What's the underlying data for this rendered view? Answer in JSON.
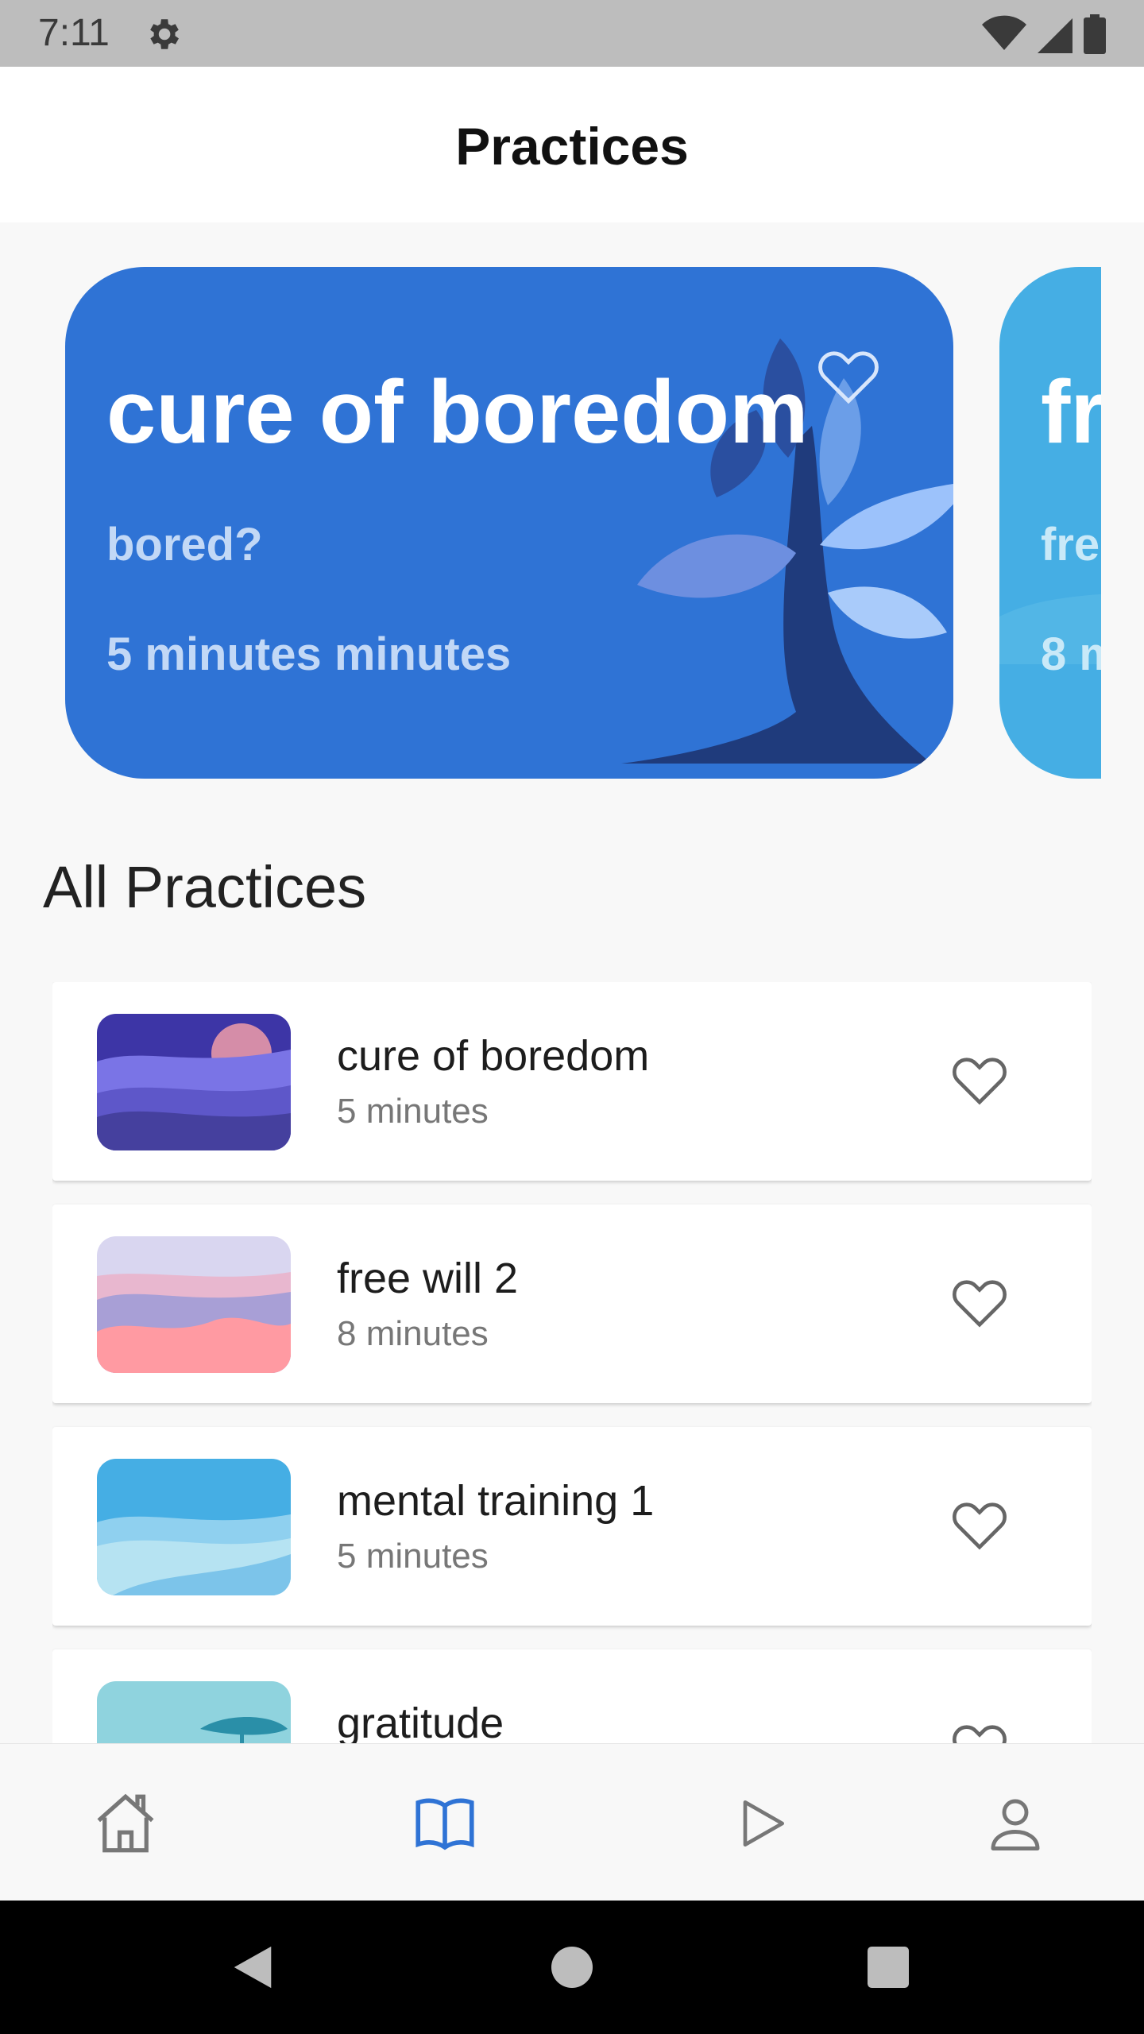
{
  "status_bar": {
    "time": "7:11"
  },
  "header": {
    "title": "Practices"
  },
  "featured": [
    {
      "title": "cure of boredom",
      "subtitle": "bored?",
      "duration": "5 minutes minutes"
    },
    {
      "title": "fr",
      "subtitle": "fre",
      "duration": "8 m"
    }
  ],
  "section": {
    "title": "All Practices"
  },
  "practices": [
    {
      "title": "cure of boredom",
      "duration": "5 minutes"
    },
    {
      "title": "free will 2",
      "duration": "8 minutes"
    },
    {
      "title": "mental training 1",
      "duration": "5 minutes"
    },
    {
      "title": "gratitude",
      "duration": ""
    }
  ],
  "colors": {
    "primary_card": "#2f73d5",
    "secondary_card": "#45aee4",
    "nav_active": "#2f73d5",
    "nav_inactive": "#777777"
  },
  "bottom_nav": [
    {
      "icon": "home-icon",
      "active": false
    },
    {
      "icon": "book-icon",
      "active": true
    },
    {
      "icon": "play-icon",
      "active": false
    },
    {
      "icon": "profile-icon",
      "active": false
    }
  ]
}
